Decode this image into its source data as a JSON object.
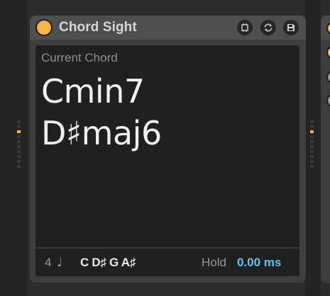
{
  "device": {
    "title": "Chord Sight",
    "header_buttons": [
      {
        "icon": "fit-icon"
      },
      {
        "icon": "refresh-icon"
      },
      {
        "icon": "save-icon"
      }
    ],
    "accent_color": "#f5b445"
  },
  "panel": {
    "label": "Current Chord",
    "chords": [
      "Cmin7",
      "D♯maj6"
    ]
  },
  "footer": {
    "voices": "4",
    "note_icon": "♩",
    "notes": "C D♯ G A♯",
    "hold_label": "Hold",
    "hold_value": "0.00 ms",
    "value_color": "#5fc3f2"
  }
}
